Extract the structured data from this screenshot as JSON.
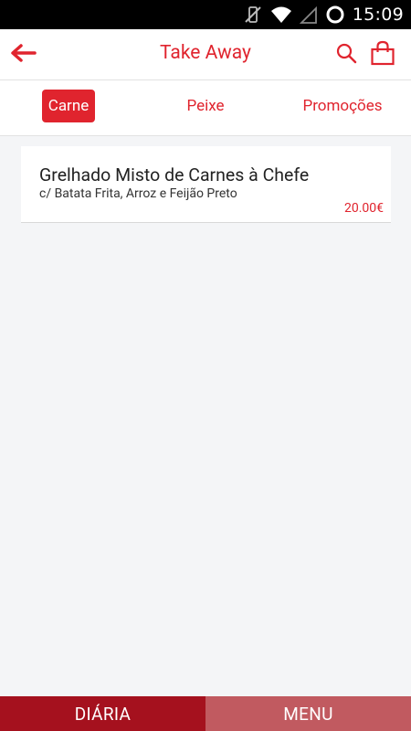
{
  "status_bar": {
    "time": "15:09"
  },
  "app_bar": {
    "title": "Take Away"
  },
  "tabs": [
    {
      "label": "Carne",
      "active": true
    },
    {
      "label": "Peixe",
      "active": false
    },
    {
      "label": "Promoções",
      "active": false
    }
  ],
  "items": [
    {
      "name": "Grelhado Misto de Carnes à Chefe",
      "description": "c/ Batata Frita, Arroz e Feijão Preto",
      "price": "20.00€"
    }
  ],
  "bottom_nav": {
    "diaria_label": "DIÁRIA",
    "menu_label": "MENU"
  },
  "colors": {
    "accent": "#e0242e",
    "nav_active": "#a5111e",
    "nav_inactive": "#c15a60"
  }
}
